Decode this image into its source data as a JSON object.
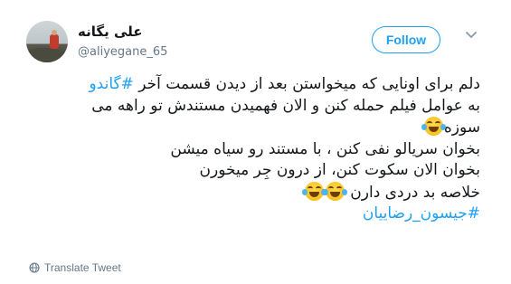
{
  "user": {
    "display_name": "علی یگانه",
    "handle": "@aliyegane_65"
  },
  "follow_button_label": "Follow",
  "tweet": {
    "lines": [
      {
        "text": "دلم برای اونایی که میخواستن بعد از دیدن قسمت آخر ",
        "hashtag": "#گاندو"
      },
      {
        "text": "به عوامل فیلم حمله کنن و الان فهمیدن مستندش تو راهه می"
      },
      {
        "text": "سوزه",
        "emoji": "face-with-tears-of-joy"
      },
      {
        "text": "بخوان سریالو نفی کنن ، با مستند رو سیاه میشن"
      },
      {
        "text": "بخوان الان سکوت کنن، از درون جِر میخورن"
      },
      {
        "text": "خلاصه بد دردی دارن",
        "emoji_count": 2
      },
      {
        "hashtag": "#جیسون_رضاییان"
      }
    ]
  },
  "translate_label": "Translate Tweet",
  "icons": {
    "more": "chevron-down-icon",
    "translate": "globe-icon",
    "emoji": "face-with-tears-of-joy"
  },
  "colors": {
    "accent": "#1da1f2",
    "text": "#14171a",
    "secondary": "#657786"
  }
}
